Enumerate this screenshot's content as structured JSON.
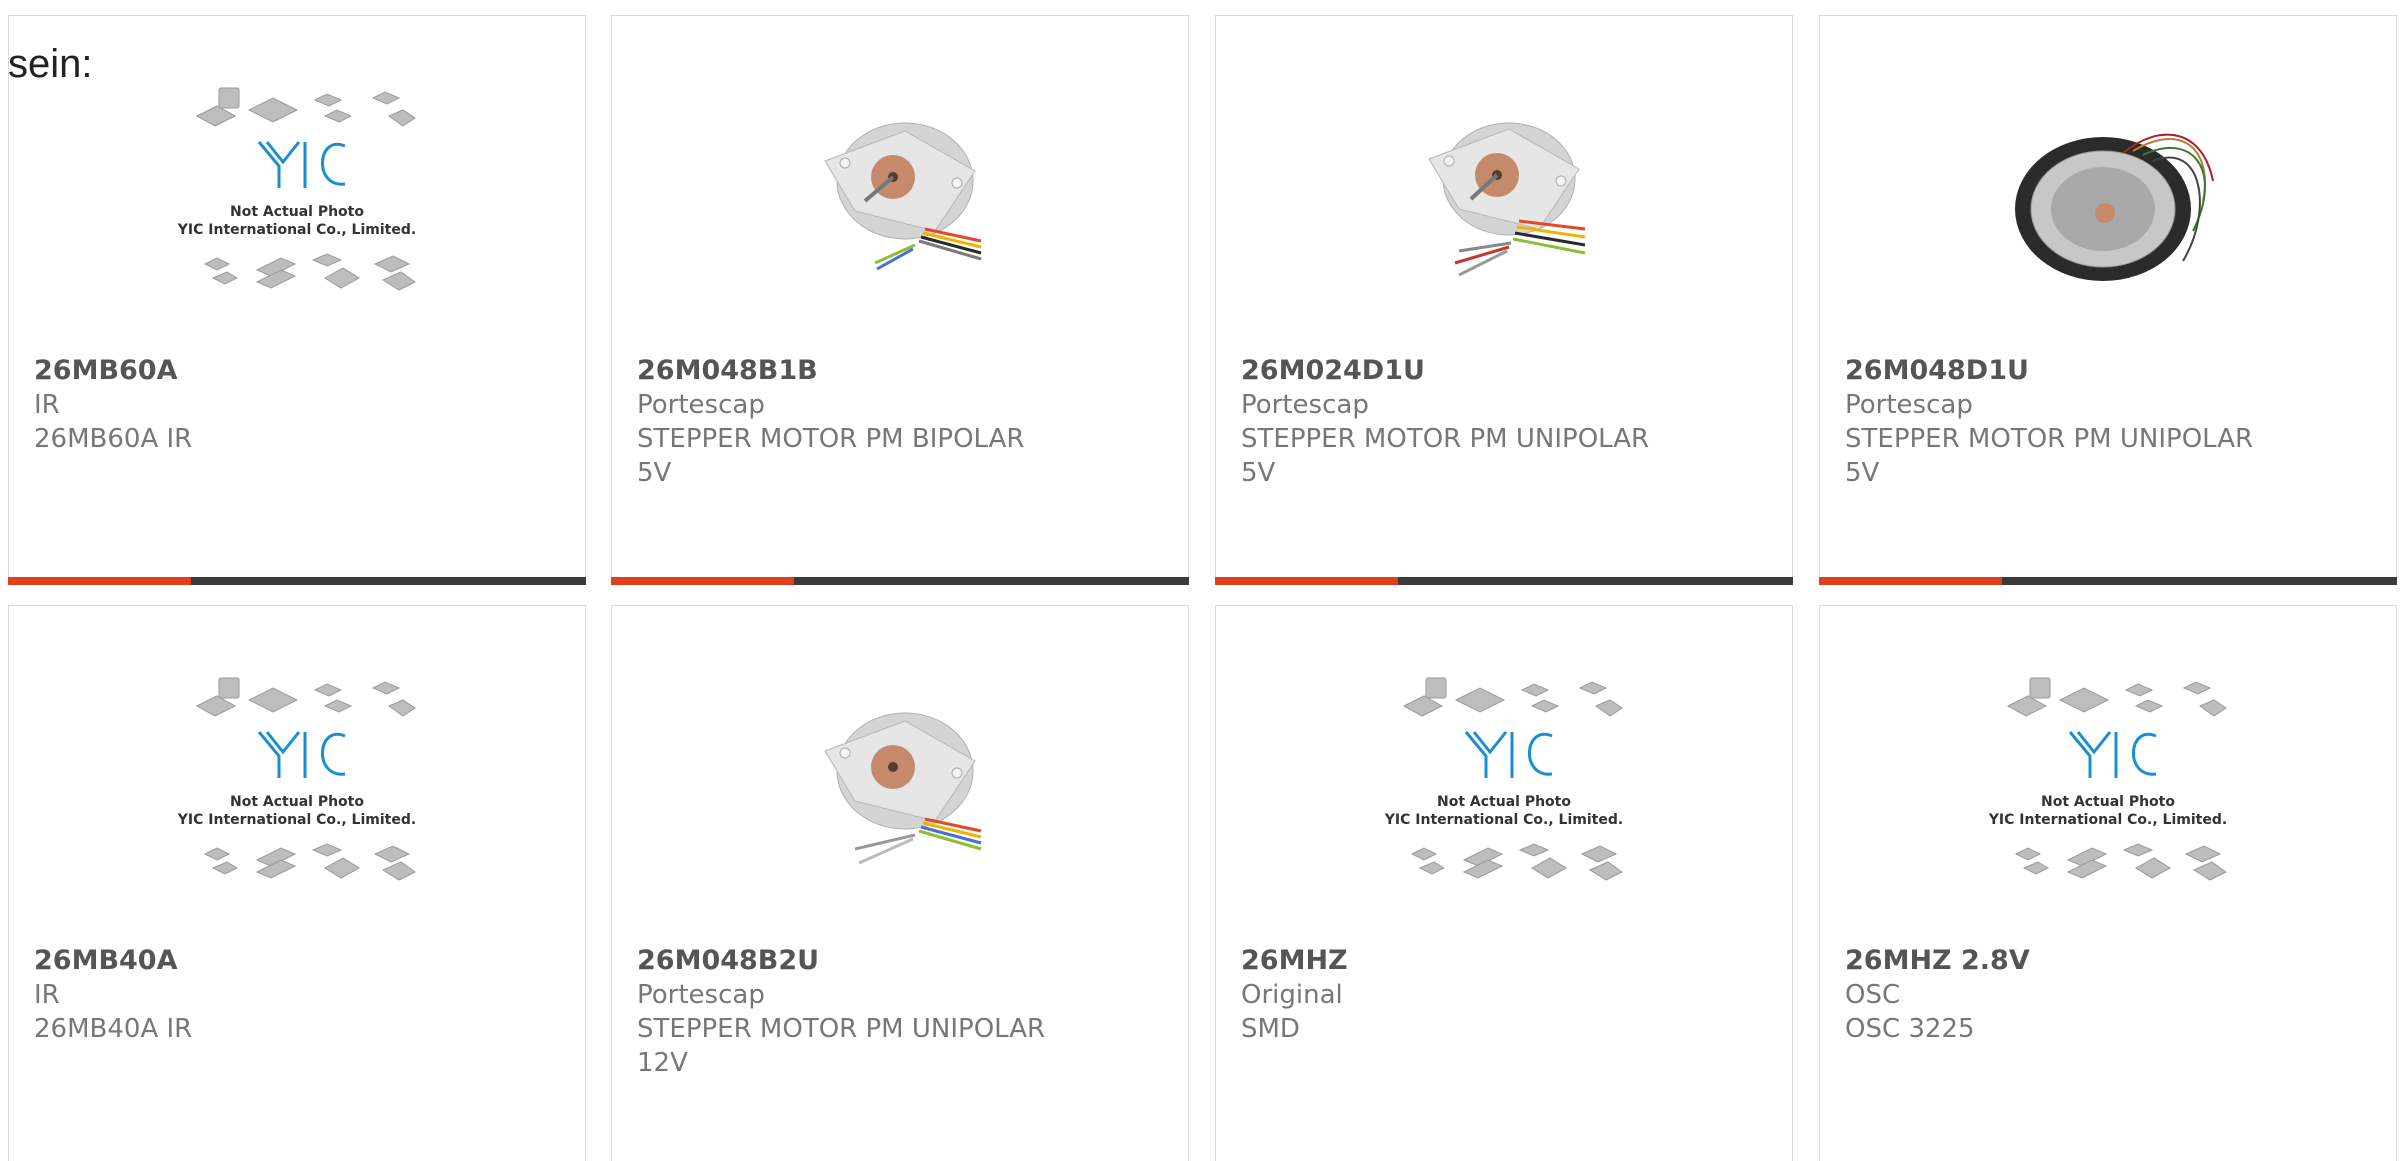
{
  "intro": "sein:",
  "placeholder": {
    "caption1": "Not Actual Photo",
    "caption2": "YIC International Co., Limited.",
    "logo": "YIC"
  },
  "products": [
    {
      "pn": "26MB60A",
      "maker": "IR",
      "desc": "26MB60A IR",
      "image": "placeholder"
    },
    {
      "pn": "26M048B1B",
      "maker": "Portescap",
      "desc": "STEPPER MOTOR PM BIPOLAR 5V",
      "image": "motor"
    },
    {
      "pn": "26M024D1U",
      "maker": "Portescap",
      "desc": "STEPPER MOTOR PM UNIPOLAR 5V",
      "image": "motor"
    },
    {
      "pn": "26M048D1U",
      "maker": "Portescap",
      "desc": "STEPPER MOTOR PM UNIPOLAR 5V",
      "image": "motor-dark"
    },
    {
      "pn": "26MB40A",
      "maker": "IR",
      "desc": "26MB40A IR",
      "image": "placeholder"
    },
    {
      "pn": "26M048B2U",
      "maker": "Portescap",
      "desc": "STEPPER MOTOR PM UNIPOLAR 12V",
      "image": "motor"
    },
    {
      "pn": "26MHZ",
      "maker": "Original",
      "desc": "SMD",
      "image": "placeholder"
    },
    {
      "pn": "26MHZ 2.8V",
      "maker": "OSC",
      "desc": "OSC 3225",
      "image": "placeholder"
    }
  ],
  "colors": {
    "accent": "#e2401c",
    "bar": "#3b3b3b",
    "logo": "#1a8fd0"
  }
}
